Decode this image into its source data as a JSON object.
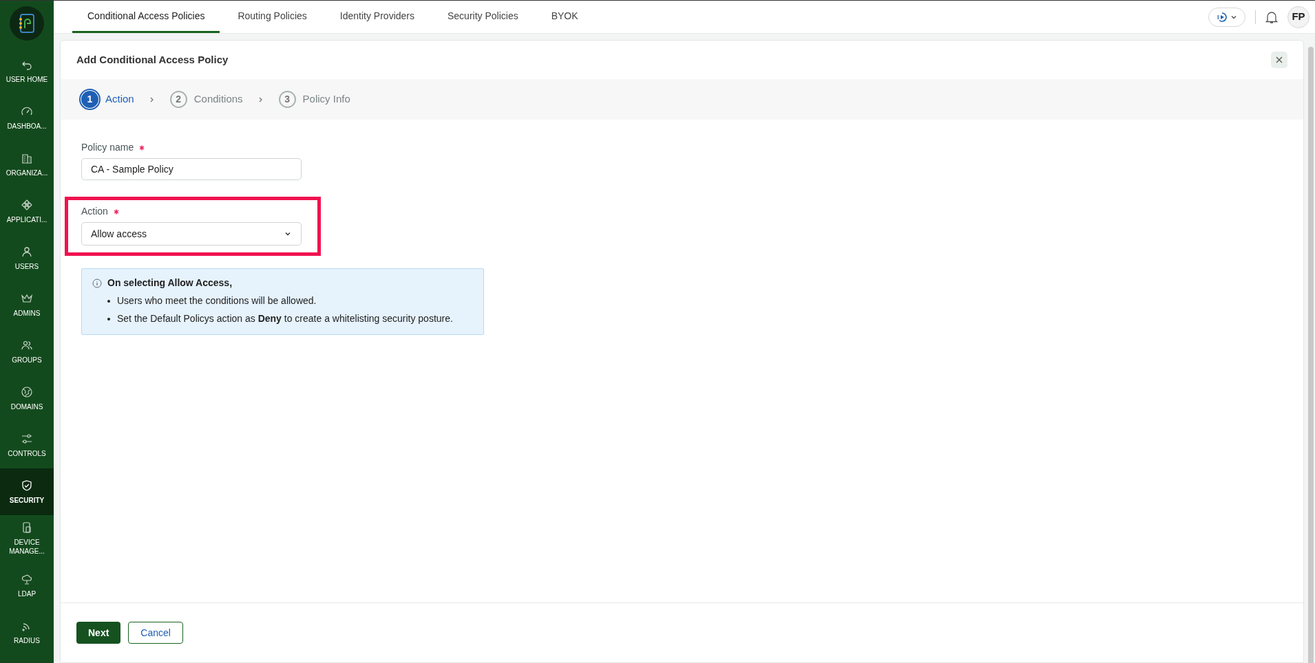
{
  "sidebar": {
    "items": [
      {
        "label": "USER HOME",
        "selected": false
      },
      {
        "label": "DASHBOA...",
        "selected": false
      },
      {
        "label": "ORGANIZA...",
        "selected": false
      },
      {
        "label": "APPLICATI...",
        "selected": false
      },
      {
        "label": "USERS",
        "selected": false
      },
      {
        "label": "ADMINS",
        "selected": false
      },
      {
        "label": "GROUPS",
        "selected": false
      },
      {
        "label": "DOMAINS",
        "selected": false
      },
      {
        "label": "CONTROLS",
        "selected": false
      },
      {
        "label": "SECURITY",
        "selected": true
      },
      {
        "label": "DEVICE MANAGE...",
        "selected": false
      },
      {
        "label": "LDAP",
        "selected": false
      },
      {
        "label": "RADIUS",
        "selected": false
      }
    ]
  },
  "tabs": [
    {
      "label": "Conditional Access Policies",
      "selected": true
    },
    {
      "label": "Routing Policies",
      "selected": false
    },
    {
      "label": "Identity Providers",
      "selected": false
    },
    {
      "label": "Security Policies",
      "selected": false
    },
    {
      "label": "BYOK",
      "selected": false
    }
  ],
  "avatar": "FP",
  "panel": {
    "title": "Add Conditional Access Policy",
    "steps": [
      {
        "number": "1",
        "label": "Action",
        "selected": true
      },
      {
        "number": "2",
        "label": "Conditions",
        "selected": false
      },
      {
        "number": "3",
        "label": "Policy Info",
        "selected": false
      }
    ],
    "fields": [
      {
        "kind": "text",
        "label": "Policy name",
        "required": true,
        "value": "CA - Sample Policy",
        "highlighted": false
      },
      {
        "kind": "select",
        "label": "Action",
        "required": true,
        "value": "Allow access",
        "highlighted": true
      }
    ],
    "info": {
      "title": "On selecting Allow Access,",
      "bullets": [
        "Users who meet the conditions will be allowed.",
        "Set the Default Policys action as **Deny** to create a whitelisting security posture."
      ]
    },
    "buttons": [
      {
        "kind": "primary",
        "label": "Next"
      },
      {
        "kind": "secondary",
        "label": "Cancel"
      }
    ]
  }
}
